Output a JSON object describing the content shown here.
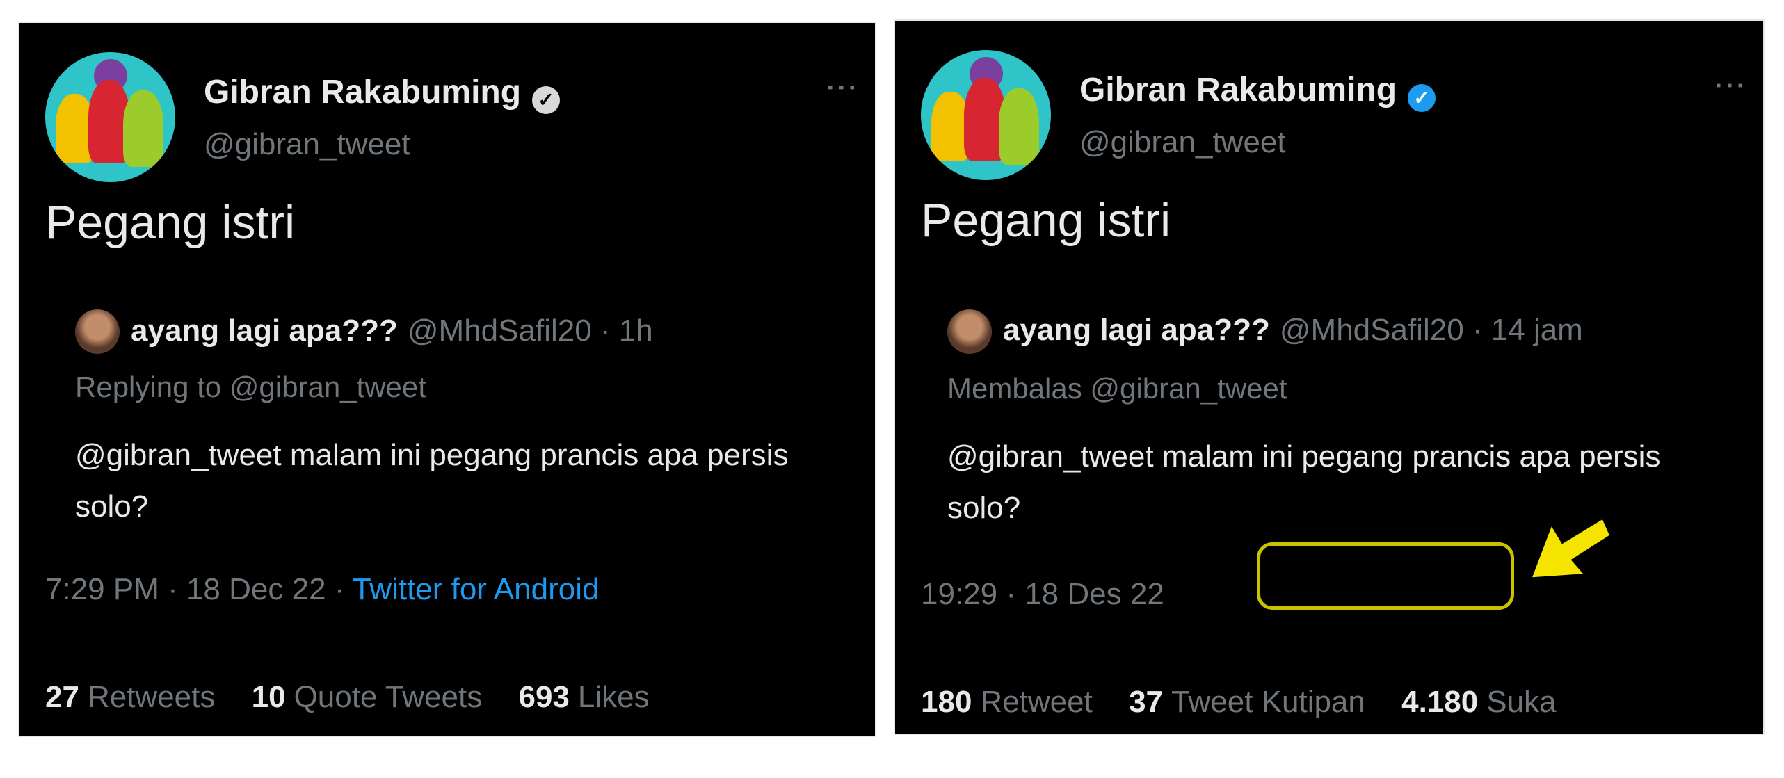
{
  "left": {
    "author": {
      "name": "Gibran Rakabuming",
      "verified_mark": "✓",
      "handle": "@gibran_tweet"
    },
    "more_icon": "⋮",
    "tweet_text": "Pegang istri",
    "quote": {
      "name": "ayang lagi apa???",
      "meta": "@MhdSafil20 · 1h",
      "replying": "Replying to @gibran_tweet",
      "body": "@gibran_tweet malam ini pegang prancis apa persis solo?"
    },
    "timestamp": "7:29 PM · 18 Dec 22 · ",
    "source": "Twitter for Android",
    "stats": {
      "retweets_count": "27",
      "retweets_label": "Retweets",
      "quotes_count": "10",
      "quotes_label": "Quote Tweets",
      "likes_count": "693",
      "likes_label": "Likes"
    }
  },
  "right": {
    "author": {
      "name": "Gibran Rakabuming",
      "verified_mark": "✓",
      "handle": "@gibran_tweet"
    },
    "more_icon": "⋮",
    "tweet_text": "Pegang istri",
    "quote": {
      "name": "ayang lagi apa???",
      "meta": "@MhdSafil20 · 14 jam",
      "replying": "Membalas @gibran_tweet",
      "body": "@gibran_tweet malam ini pegang prancis apa persis solo?"
    },
    "timestamp": "19:29 · 18 Des 22",
    "stats": {
      "retweets_count": "180",
      "retweets_label": "Retweet",
      "quotes_count": "37",
      "quotes_label": "Tweet Kutipan",
      "likes_count": "4.180",
      "likes_label": "Suka"
    }
  },
  "colors": {
    "background": "#000000",
    "text_primary": "#e7e9ea",
    "text_secondary": "#71767b",
    "link_blue": "#1d9bf0",
    "highlight_yellow": "#c9c200",
    "arrow_yellow": "#f5e400"
  },
  "icons": {
    "verified": "verified-badge-icon",
    "more": "more-options-icon",
    "arrow": "yellow-arrow-annotation-icon"
  }
}
